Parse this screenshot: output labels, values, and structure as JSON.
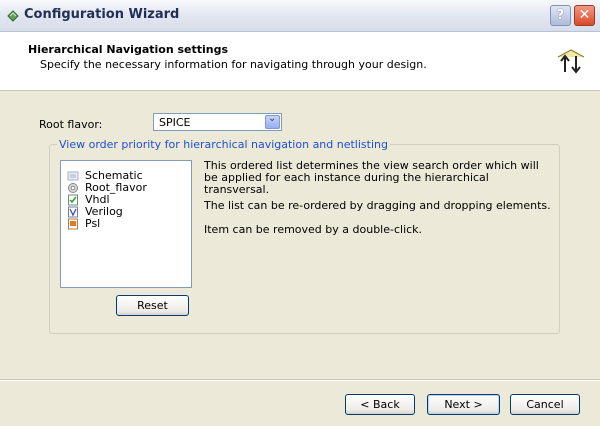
{
  "window": {
    "title": "Configuration Wizard",
    "help_label": "?",
    "close_label": "✕"
  },
  "header": {
    "title": "Hierarchical Navigation settings",
    "subtitle": "Specify the necessary information for navigating through your design."
  },
  "root_flavor": {
    "label": "Root flavor:",
    "value": "SPICE"
  },
  "view_order": {
    "legend": "View order priority for hierarchical navigation and netlisting",
    "items": [
      {
        "label": "Schematic",
        "icon": "schematic-icon"
      },
      {
        "label": "Root_flavor",
        "icon": "gear-icon"
      },
      {
        "label": "Vhdl",
        "icon": "vhdl-file-icon"
      },
      {
        "label": "Verilog",
        "icon": "verilog-file-icon"
      },
      {
        "label": "Psl",
        "icon": "psl-file-icon"
      }
    ],
    "reset_label": "Reset",
    "info_1": "This ordered list determines the view search order which will be applied for each instance during the hierarchical transversal.",
    "info_2": "The list can be re-ordered by dragging and dropping elements.",
    "info_3": "Item can be removed by a double-click."
  },
  "footer": {
    "back_label": "< Back",
    "next_label": "Next >",
    "cancel_label": "Cancel"
  }
}
